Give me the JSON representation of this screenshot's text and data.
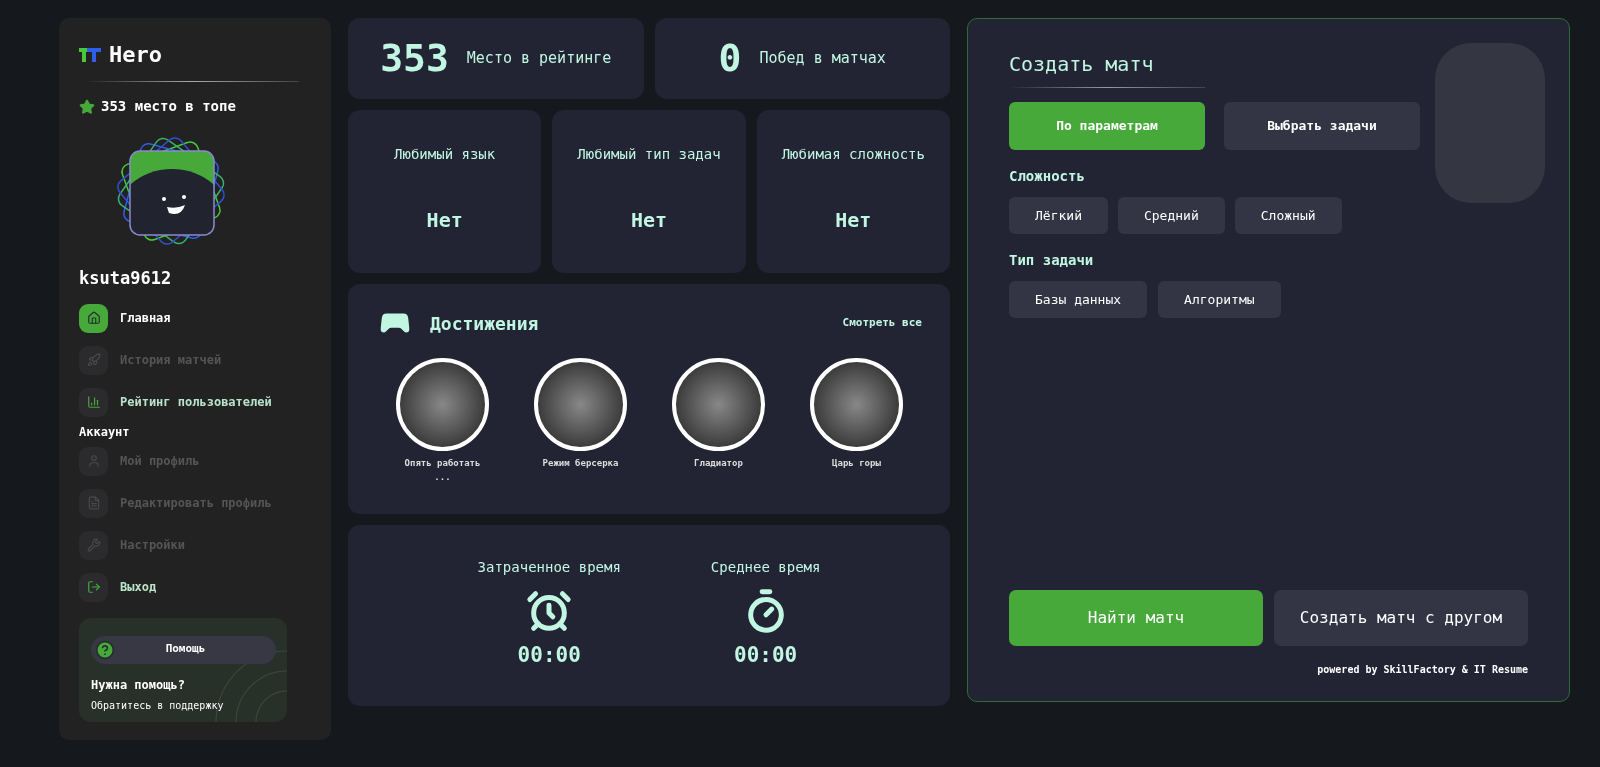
{
  "sidebar": {
    "logo": "Hero",
    "rank": "353 место в топе",
    "username": "ksuta9612",
    "nav": [
      {
        "label": "Главная",
        "kind": "home",
        "selected": true,
        "disabled": false
      },
      {
        "label": "История матчей",
        "kind": "rocket",
        "selected": false,
        "disabled": true
      },
      {
        "label": "Рейтинг пользователей",
        "kind": "chart",
        "selected": false,
        "disabled": false
      }
    ],
    "account_heading": "Аккаунт",
    "account": [
      {
        "label": "Мой профиль",
        "kind": "user",
        "selected": false,
        "disabled": true
      },
      {
        "label": "Редактировать профиль",
        "kind": "file",
        "selected": false,
        "disabled": true
      },
      {
        "label": "Настройки",
        "kind": "wrench",
        "selected": false,
        "disabled": true
      },
      {
        "label": "Выход",
        "kind": "exit",
        "selected": false,
        "disabled": false
      }
    ],
    "help": {
      "button": "Помощь",
      "title": "Нужна помощь?",
      "text": "Обратитесь в поддержку"
    }
  },
  "stats": [
    {
      "value": "353",
      "label": "Место в рейтинге"
    },
    {
      "value": "0",
      "label": "Побед в матчах"
    }
  ],
  "favorites": [
    {
      "label": "Любимый язык",
      "value": "Нет"
    },
    {
      "label": "Любимый тип задач",
      "value": "Нет"
    },
    {
      "label": "Любимая сложность",
      "value": "Нет"
    }
  ],
  "achievements": {
    "title": "Достижения",
    "link": "Смотреть все",
    "items": [
      {
        "label": "Опять работать ..."
      },
      {
        "label": "Режим берсерка"
      },
      {
        "label": "Гладиатор"
      },
      {
        "label": "Царь горы"
      }
    ]
  },
  "times": [
    {
      "label": "Затраченное время",
      "kind": "alarm",
      "value": "00:00"
    },
    {
      "label": "Среднее время",
      "kind": "stopwatch",
      "value": "00:00"
    }
  ],
  "create_match": {
    "title": "Создать матч",
    "modes": [
      {
        "label": "По параметрам",
        "selected": true
      },
      {
        "label": "Выбрать задачи",
        "selected": false
      }
    ],
    "difficulty_heading": "Сложность",
    "difficulties": [
      {
        "label": "Лёгкий",
        "selected": false
      },
      {
        "label": "Средний",
        "selected": false
      },
      {
        "label": "Сложный",
        "selected": false
      }
    ],
    "type_heading": "Тип задачи",
    "types": [
      {
        "label": "Базы данных",
        "selected": false
      },
      {
        "label": "Алгоритмы",
        "selected": false
      }
    ],
    "actions": [
      {
        "label": "Найти матч",
        "kind": "primary"
      },
      {
        "label": "Создать матч с другом",
        "kind": "secondary"
      }
    ],
    "footer": "powered by SkillFactory & IT Resume"
  }
}
